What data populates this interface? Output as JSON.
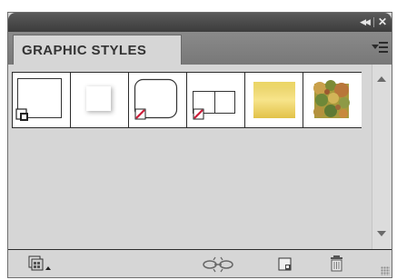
{
  "window": {
    "collapse_icon": "double-chevron-left-icon",
    "close_icon": "close-icon"
  },
  "panel": {
    "tab_label": "GRAPHIC STYLES",
    "menu_icon": "panel-menu-icon"
  },
  "swatches": [
    {
      "name": "default-graphic-style",
      "icon": "default-style-icon"
    },
    {
      "name": "soft-drop-shadow-style",
      "icon": "drop-shadow-icon"
    },
    {
      "name": "rounded-corners-style",
      "icon": "rounded-corners-icon"
    },
    {
      "name": "drop-shadow-offset-style",
      "icon": "offset-shadow-icon"
    },
    {
      "name": "yellow-glow-style",
      "accent": "#e9cb55"
    },
    {
      "name": "camouflage-texture-style",
      "accent": "#8c9a3c"
    }
  ],
  "toolbar": {
    "libraries_icon": "graphic-style-libraries-icon",
    "break_link_icon": "break-link-icon",
    "new_style_icon": "new-graphic-style-icon",
    "delete_icon": "trash-icon"
  },
  "colors": {
    "panel_bg": "#d6d6d6",
    "title_bar": "#3c3c3c",
    "none_swatch_red": "#cc1e3a"
  }
}
